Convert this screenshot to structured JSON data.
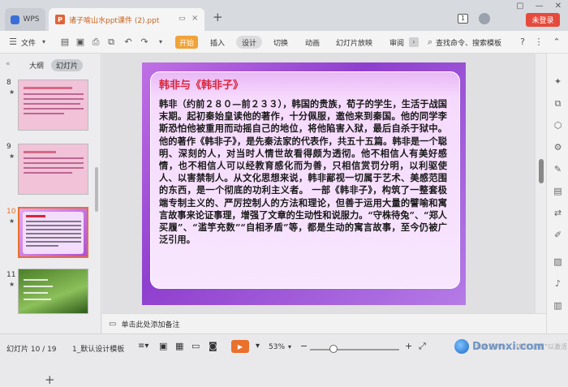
{
  "window": {
    "app_tab": "WPS",
    "doc_tab": "诸子喻山水ppt课件 (2).ppt",
    "login_button": "未登录",
    "page_count_badge": "1"
  },
  "ribbon": {
    "file_menu": "文件",
    "tabs": [
      "开始",
      "插入",
      "设计",
      "切换",
      "动画",
      "幻灯片放映",
      "审阅"
    ],
    "active_tab": "设计",
    "search_label": "查找命令、搜索模板"
  },
  "left_panel": {
    "tabs": [
      "大纲",
      "幻灯片"
    ],
    "active_tab": "幻灯片",
    "slides": [
      {
        "number": "8",
        "theme": "pink"
      },
      {
        "number": "9",
        "theme": "pink"
      },
      {
        "number": "10",
        "theme": "purple",
        "selected": true
      },
      {
        "number": "11",
        "theme": "green"
      }
    ]
  },
  "slide": {
    "heading": "韩非与《韩非子》",
    "body": "韩非（约前２８０—前２３３），韩国的贵族，荀子的学生，生活于战国末期。起初秦始皇读他的著作，十分佩服，邀他来到秦国。他的同学李斯恐怕他被重用而动摇自己的地位，将他陷害入狱，最后自杀于狱中。他的著作《韩非子》，是先秦法家的代表作，共五十五篇。韩非是一个聪明、深刻的人，对当时人情世故看得颇为透彻。他不相信人有美好感情，也不相信人可以经教育感化而为善，只相信赏罚分明，以利驱使人、以害禁制人。从文化思想来说，韩非鄙视一切属于艺术、美感范围的东西，是一个彻底的功利主义者。 一部《韩非子》，构筑了一整套极端专制主义的、严厉控制人的方法和理论，但善于运用大量的譬喻和寓言故事来论证事理，增强了文章的生动性和说服力。“守株待兔”、“郑人买履”、“滥竽充数”“自相矛盾”等，都是生动的寓言故事，至今仍被广泛引用。"
  },
  "notes": {
    "placeholder": "单击此处添加备注"
  },
  "status_bar": {
    "slide_position": "幻灯片 10 / 19",
    "theme_name": "1_默认设计模板",
    "zoom": "53%",
    "zoom_level": 0.53
  },
  "watermark": {
    "text": "Downxi.com",
    "overlay_text": "表激活Win… 转到\"设置\"以激活"
  }
}
